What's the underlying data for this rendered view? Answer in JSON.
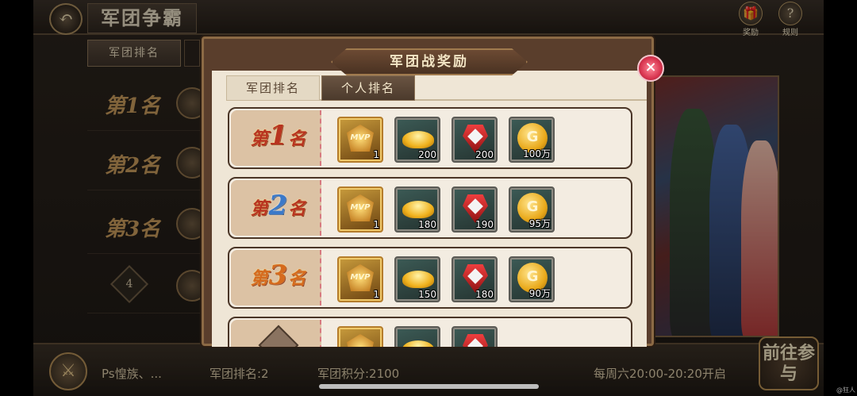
{
  "header": {
    "back_icon": "↶",
    "title": "军团争霸",
    "reward_label": "奖励",
    "reward_icon": "🎁",
    "rules_label": "规则",
    "rules_icon": "?"
  },
  "left_tab": {
    "label": "军团排名"
  },
  "background_list": [
    {
      "rank": "第1名"
    },
    {
      "rank": "第2名"
    },
    {
      "rank": "第3名"
    },
    {
      "rank": "4"
    }
  ],
  "bottom": {
    "guild_name": "Ps惶族、...",
    "rank_text": "军团排名:2",
    "score_text": "军团积分:2100",
    "schedule_text": "每周六20:00-20:20开启",
    "go_button": "前往参与"
  },
  "modal": {
    "title": "军团战奖励",
    "close_icon": "×",
    "tabs": [
      "军团排名",
      "个人排名"
    ],
    "active_tab": "个人排名",
    "rows": [
      {
        "prefix": "第",
        "num": "1",
        "suffix": "名",
        "items": [
          {
            "icon": "mvp",
            "label": "MVP",
            "qty": "1"
          },
          {
            "icon": "gold-ingot",
            "qty": "200"
          },
          {
            "icon": "red-shield",
            "qty": "200"
          },
          {
            "icon": "gold-coin",
            "label": "G",
            "qty": "100万"
          }
        ]
      },
      {
        "prefix": "第",
        "num": "2",
        "suffix": "名",
        "items": [
          {
            "icon": "mvp",
            "label": "MVP",
            "qty": "1"
          },
          {
            "icon": "gold-ingot",
            "qty": "180"
          },
          {
            "icon": "red-shield",
            "qty": "190"
          },
          {
            "icon": "gold-coin",
            "label": "G",
            "qty": "95万"
          }
        ]
      },
      {
        "prefix": "第",
        "num": "3",
        "suffix": "名",
        "items": [
          {
            "icon": "mvp",
            "label": "MVP",
            "qty": "1"
          },
          {
            "icon": "gold-ingot",
            "qty": "150"
          },
          {
            "icon": "red-shield",
            "qty": "180"
          },
          {
            "icon": "gold-coin",
            "label": "G",
            "qty": "90万"
          }
        ]
      }
    ]
  },
  "watermark": "@狂人"
}
